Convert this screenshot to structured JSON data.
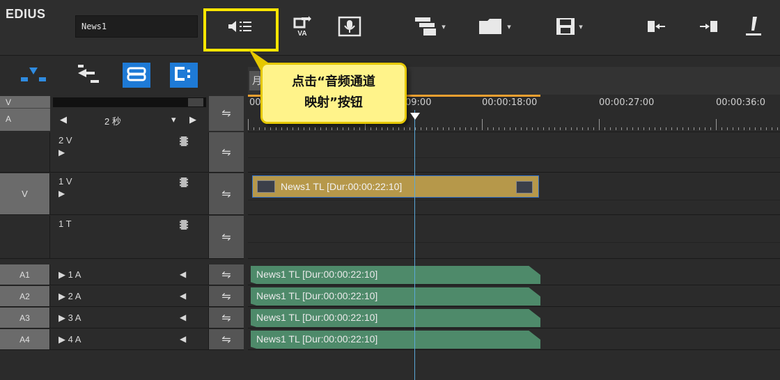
{
  "app": {
    "brand": "EDIUS",
    "sequence_name": "News1"
  },
  "toolbar": {
    "icons": [
      "audio-channel-map-icon",
      "export-va-icon",
      "voiceover-mic-icon",
      "clip-menu-icon",
      "folder-icon",
      "save-icon",
      "mark-in-icon",
      "mark-out-icon",
      "marker-icon"
    ],
    "export_label": "VA",
    "dropdown_glyph": "▾"
  },
  "track_tools": {
    "icons": [
      "track-mode-icon",
      "ripple-icon",
      "link-icon",
      "sync-icon"
    ]
  },
  "va_panel": {
    "v_label": "V",
    "a_label": "A",
    "zoom_value": "2 秒",
    "prev_glyph": "◀",
    "next_glyph": "▶",
    "dropdown_glyph": "▾"
  },
  "tl_tab_label": "月",
  "ruler": {
    "timecodes": [
      "00",
      "09:00",
      "00:00:18:00",
      "00:00:27:00",
      "00:00:36:0"
    ]
  },
  "tracks": [
    {
      "id": "2V",
      "label": "2 V",
      "channel": "",
      "arrow": "▶",
      "swap": "⇋"
    },
    {
      "id": "1V",
      "label": "1 V",
      "channel": "V",
      "arrow": "▶",
      "swap": "⇋"
    },
    {
      "id": "1T",
      "label": "1 T",
      "channel": "",
      "arrow": "",
      "swap": "⇋"
    },
    {
      "id": "1A",
      "label": "1 A",
      "channel": "A1",
      "arrow": "▶",
      "swap": "⇋",
      "speaker": "◀"
    },
    {
      "id": "2A",
      "label": "2 A",
      "channel": "A2",
      "arrow": "▶",
      "swap": "⇋",
      "speaker": "◀"
    },
    {
      "id": "3A",
      "label": "3 A",
      "channel": "A3",
      "arrow": "▶",
      "swap": "⇋",
      "speaker": "◀"
    },
    {
      "id": "4A",
      "label": "4 A",
      "channel": "A4",
      "arrow": "▶",
      "swap": "⇋",
      "speaker": "◀"
    }
  ],
  "clips": {
    "video": "News1  TL [Dur:00:00:22:10]",
    "audio": [
      "News1  TL [Dur:00:00:22:10]",
      "News1  TL [Dur:00:00:22:10]",
      "News1  TL [Dur:00:00:22:10]",
      "News1  TL [Dur:00:00:22:10]"
    ]
  },
  "callout": {
    "line1": "点击“音频通道",
    "line2": "映射”按钮"
  },
  "colors": {
    "highlight": "#ffe600",
    "video_clip": "#b6984a",
    "audio_clip": "#4e8a6a",
    "accent_blue": "#1e7ad6",
    "playhead": "#5aa8d8"
  }
}
